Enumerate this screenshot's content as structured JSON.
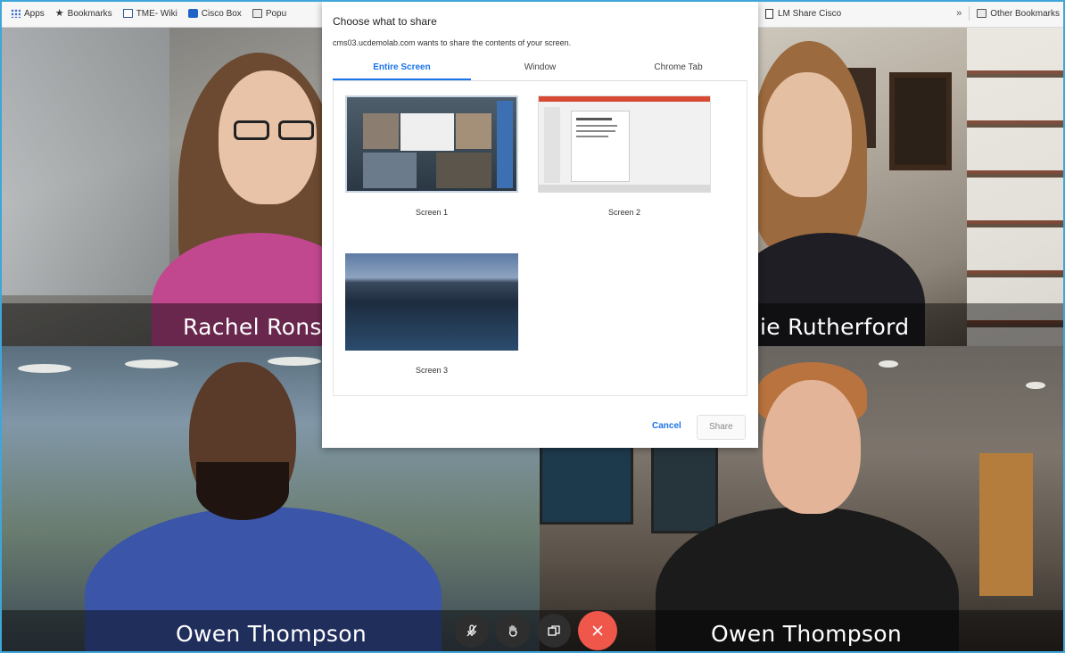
{
  "bookmarks_bar": {
    "items": [
      {
        "label": "Apps",
        "icon": "apps-grid-icon"
      },
      {
        "label": "Bookmarks",
        "icon": "star-icon"
      },
      {
        "label": "TME- Wiki",
        "icon": "wiki-icon"
      },
      {
        "label": "Cisco Box",
        "icon": "box-icon"
      },
      {
        "label": "Popu",
        "icon": "folder-icon"
      }
    ],
    "lm_share": {
      "label": "LM Share Cisco",
      "icon": "doc-icon"
    },
    "overflow": "»",
    "other": {
      "label": "Other Bookmarks",
      "icon": "folder-icon"
    }
  },
  "tiles": [
    {
      "name": "Rachel Rons"
    },
    {
      "name": "ie Rutherford"
    },
    {
      "name": "Owen Thompson"
    },
    {
      "name": "Owen Thompson"
    }
  ],
  "dialog": {
    "title": "Choose what to share",
    "subtitle": "cms03.ucdemolab.com wants to share the contents of your screen.",
    "tabs": [
      {
        "label": "Entire Screen",
        "active": true
      },
      {
        "label": "Window",
        "active": false
      },
      {
        "label": "Chrome Tab",
        "active": false
      }
    ],
    "screens": [
      {
        "label": "Screen 1"
      },
      {
        "label": "Screen 2"
      },
      {
        "label": "Screen 3"
      }
    ],
    "cancel_label": "Cancel",
    "share_label": "Share"
  },
  "controls": {
    "icons": [
      "mic-muted-icon",
      "raise-hand-icon",
      "layout-icon",
      "end-call-icon"
    ],
    "end_call_color": "#f0574b"
  },
  "colors": {
    "accent": "#1a73e8",
    "frame": "#3fa6d9"
  }
}
